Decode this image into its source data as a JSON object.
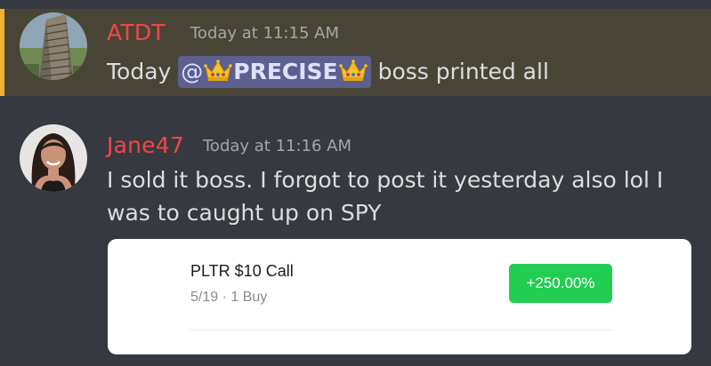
{
  "colors": {
    "background": "#36393f",
    "highlight_background": "#494536",
    "mention_bar": "#f0b232",
    "username_red": "#f04747",
    "mention_pill": "#5c5f8f",
    "gain_green": "#21ce52"
  },
  "messages": [
    {
      "author": "ATDT",
      "timestamp": "Today at 11:15 AM",
      "text_before": "Today ",
      "mention": {
        "prefix": "@",
        "name": "PRECISE",
        "emoji_name": "crown-icon"
      },
      "text_after": " boss printed all",
      "highlighted": true
    },
    {
      "author": "Jane47",
      "timestamp": "Today at 11:16 AM",
      "line1": "I sold it boss. I forgot to post it yesterday also lol I",
      "line2": "was to caught up on SPY",
      "highlighted": false,
      "embed": {
        "title": "PLTR $10 Call",
        "subtitle": "5/19 · 1 Buy",
        "badge": "+250.00%"
      }
    }
  ]
}
